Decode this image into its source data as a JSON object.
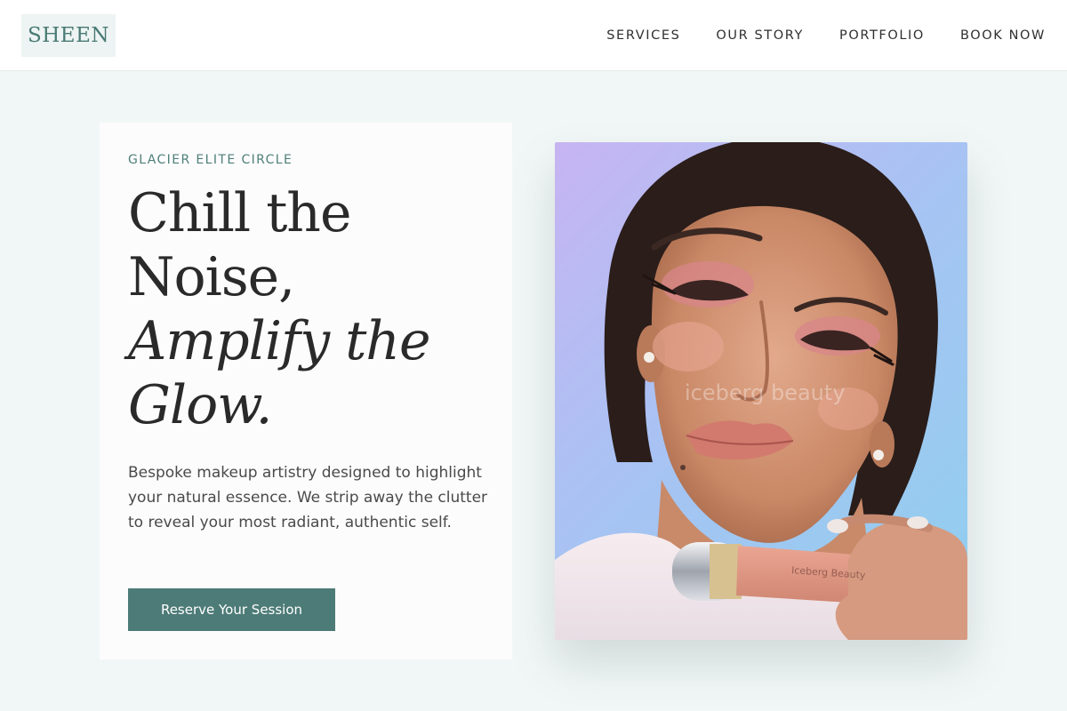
{
  "header": {
    "logo": "SHEEN",
    "nav": [
      "SERVICES",
      "OUR STORY",
      "PORTFOLIO",
      "BOOK NOW"
    ]
  },
  "hero": {
    "eyebrow": "GLACIER ELITE CIRCLE",
    "headline_line1": "Chill the",
    "headline_line2": "Noise,",
    "headline_italic1": "Amplify the",
    "headline_italic2": "Glow.",
    "description": "Bespoke makeup artistry designed to highlight your natural essence. We strip away the clutter to reveal your most radiant, authentic self.",
    "cta_label": "Reserve Your Session"
  },
  "image": {
    "subject": "portrait-with-blush-bottle",
    "watermark": "iceberg beauty",
    "product_label": "Iceberg Beauty"
  },
  "colors": {
    "background": "#f1f7f6",
    "accent": "#4d7b77",
    "logo_text": "#497a74",
    "logo_bg": "#edf4f3"
  }
}
